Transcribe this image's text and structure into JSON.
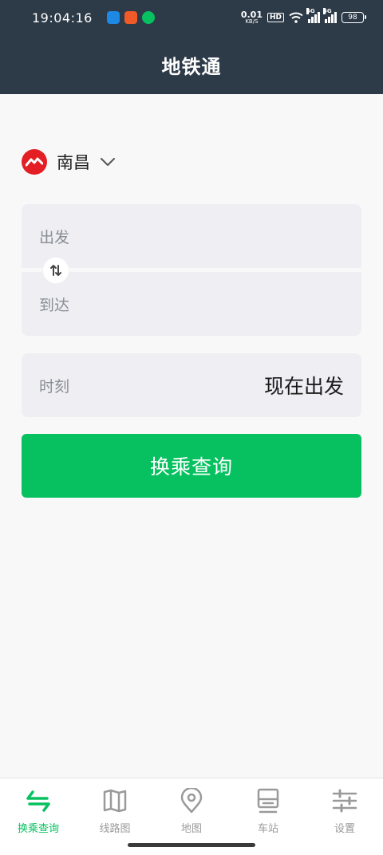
{
  "status_bar": {
    "time": "19:04:16",
    "network_speed_value": "0.01",
    "network_speed_unit": "KB/S",
    "hd_badge": "HD",
    "signal1_tag": "5G",
    "signal2_tag": "5G",
    "battery": "98",
    "app_icon_colors": [
      "#1e88e5",
      "#f05a28",
      "#07c160"
    ]
  },
  "header": {
    "title": "地铁通"
  },
  "city": {
    "name": "南昌",
    "logo_color": "#e31e24"
  },
  "route": {
    "from_placeholder": "出发",
    "to_placeholder": "到达"
  },
  "time": {
    "label": "时刻",
    "value": "现在出发"
  },
  "search_button": {
    "label": "换乘查询",
    "color": "#07c160"
  },
  "tabs": [
    {
      "label": "换乘查询",
      "icon": "transfer-icon",
      "active": true
    },
    {
      "label": "线路图",
      "icon": "map-folded-icon",
      "active": false
    },
    {
      "label": "地图",
      "icon": "location-pin-icon",
      "active": false
    },
    {
      "label": "车站",
      "icon": "station-icon",
      "active": false
    },
    {
      "label": "设置",
      "icon": "settings-sliders-icon",
      "active": false
    }
  ],
  "colors": {
    "header_bg": "#2d3a47",
    "accent": "#07c160",
    "field_bg": "#eeeef3"
  }
}
